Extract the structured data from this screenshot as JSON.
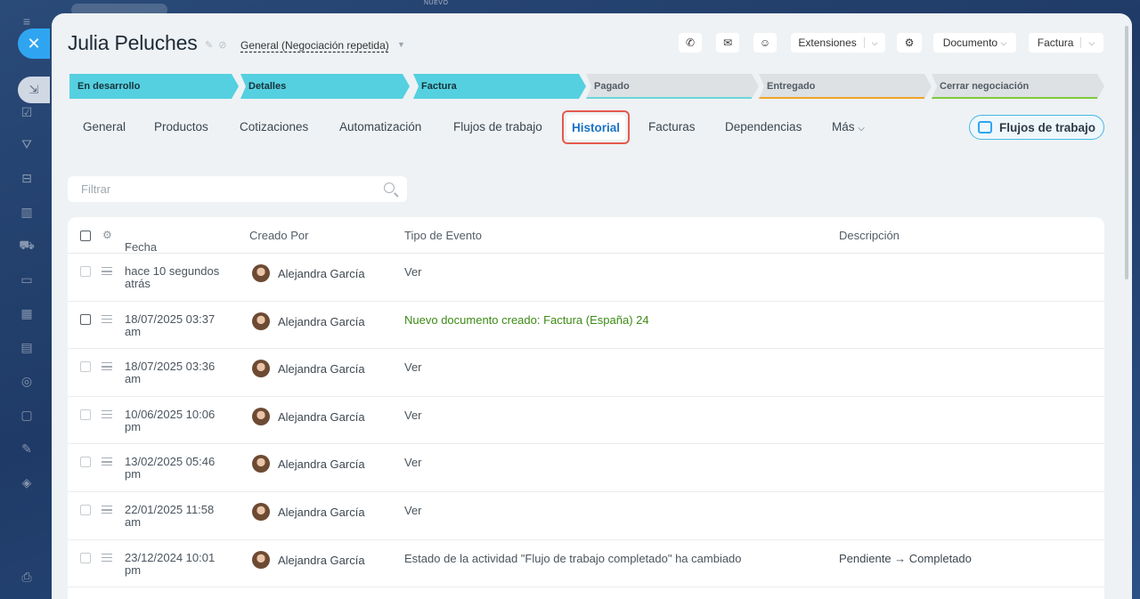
{
  "background": {
    "new_badge": "NUEVO"
  },
  "deal": {
    "title": "Julia Peluches",
    "pipeline": "General (Negociación repetida)"
  },
  "toolbar": {
    "extensions_label": "Extensiones",
    "document_label": "Documento",
    "invoice_label": "Factura"
  },
  "stages": [
    {
      "label": "En desarrollo",
      "state": "done",
      "color": "#55d0e0"
    },
    {
      "label": "Detalles",
      "state": "done",
      "color": "#55d0e0"
    },
    {
      "label": "Factura",
      "state": "done",
      "color": "#55d0e0"
    },
    {
      "label": "Pagado",
      "state": "todo",
      "color": "#6ad6dc"
    },
    {
      "label": "Entregado",
      "state": "todo",
      "color": "#f0a32a"
    },
    {
      "label": "Cerrar negociación",
      "state": "todo",
      "color": "#7fc93a"
    }
  ],
  "tabs": [
    {
      "label": "General"
    },
    {
      "label": "Productos"
    },
    {
      "label": "Cotizaciones"
    },
    {
      "label": "Automatización"
    },
    {
      "label": "Flujos de trabajo"
    },
    {
      "label": "Historial",
      "active": true
    },
    {
      "label": "Facturas"
    },
    {
      "label": "Dependencias"
    },
    {
      "label": "Más"
    }
  ],
  "workflows_button": "Flujos de trabajo",
  "filter": {
    "placeholder": "Filtrar"
  },
  "grid": {
    "columns": {
      "date": "Fecha",
      "created_by": "Creado Por",
      "event_type": "Tipo de Evento",
      "description": "Descripción"
    },
    "rows": [
      {
        "date": "hace 10 segundos atrás",
        "user": "Alejandra García",
        "event": "Ver",
        "description": ""
      },
      {
        "date": "18/07/2025 03:37 am",
        "user": "Alejandra García",
        "event": "Nuevo documento creado: Factura (España) 24",
        "description": ""
      },
      {
        "date": "18/07/2025 03:36 am",
        "user": "Alejandra García",
        "event": "Ver",
        "description": ""
      },
      {
        "date": "10/06/2025 10:06 pm",
        "user": "Alejandra García",
        "event": "Ver",
        "description": ""
      },
      {
        "date": "13/02/2025 05:46 pm",
        "user": "Alejandra García",
        "event": "Ver",
        "description": ""
      },
      {
        "date": "22/01/2025 11:58 am",
        "user": "Alejandra García",
        "event": "Ver",
        "description": ""
      },
      {
        "date": "23/12/2024 10:01 pm",
        "user": "Alejandra García",
        "event": "Estado de la actividad \"Flujo de trabajo completado\" ha cambiado",
        "description": "Pendiente → Completado"
      }
    ]
  }
}
